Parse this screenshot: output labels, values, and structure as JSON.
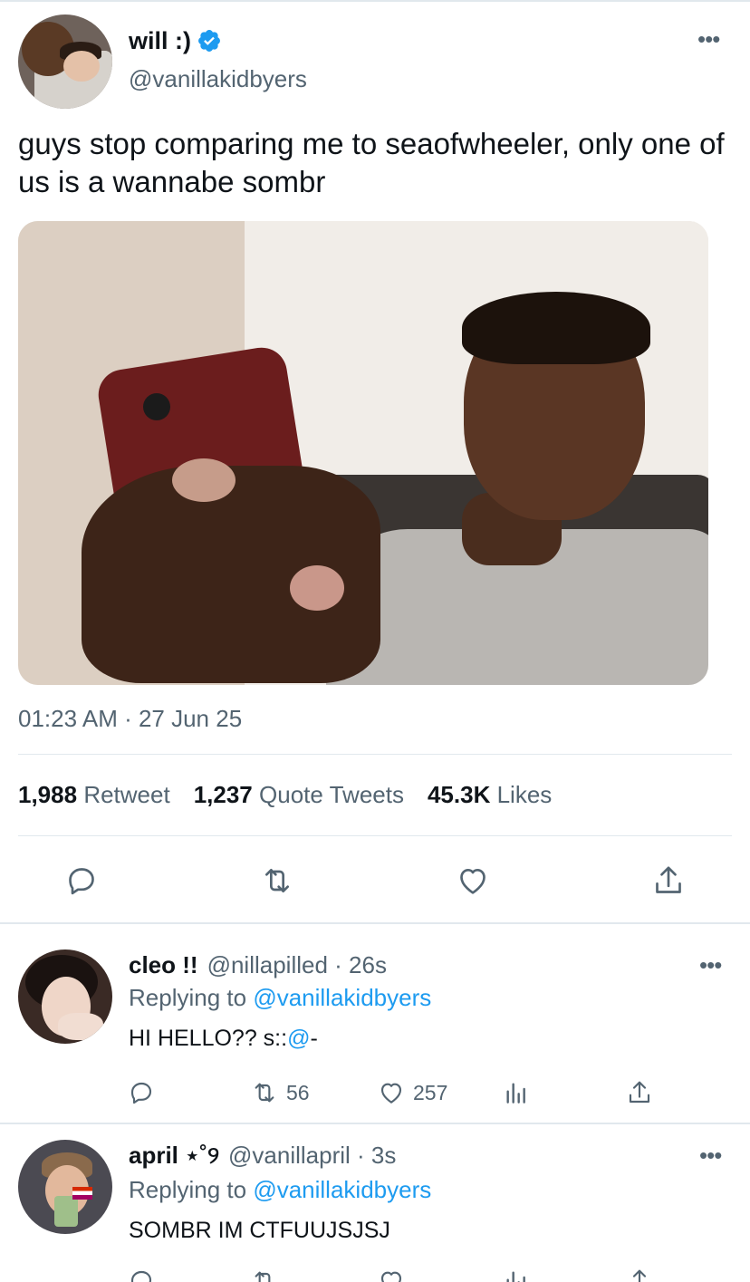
{
  "main_tweet": {
    "name": "will :)",
    "handle": "@vanillakidbyers",
    "text": "guys stop comparing me to seaofwheeler, only one of us is a wannabe sombr",
    "timestamp": "01:23 AM · 27 Jun 25",
    "stats": {
      "retweets": "1,988",
      "retweets_label": "Retweet",
      "quotes": "1,237",
      "quotes_label": "Quote Tweets",
      "likes": "45.3K",
      "likes_label": "Likes"
    },
    "more_label": "•••"
  },
  "replies": [
    {
      "name": "cleo !!",
      "handle": "@nillapilled · 26s",
      "replying_prefix": "Replying to",
      "replying_to": "@vanillakidbyers",
      "text_plain": "HI HELLO?? s::",
      "text_mention": "@",
      "text_tail": "-",
      "retweets": "56",
      "likes": "257",
      "more_label": "•••"
    },
    {
      "name": "april ⋆˚୨",
      "handle": "@vanillapril · 3s",
      "replying_prefix": "Replying to",
      "replying_to": "@vanillakidbyers",
      "text": "SOMBR IM CTFUUJSJSJ",
      "more_label": "•••"
    }
  ],
  "colors": {
    "accent": "#1d9bf0",
    "text": "#0f1419",
    "secondary": "#536471",
    "divider": "#e1e8ed"
  }
}
